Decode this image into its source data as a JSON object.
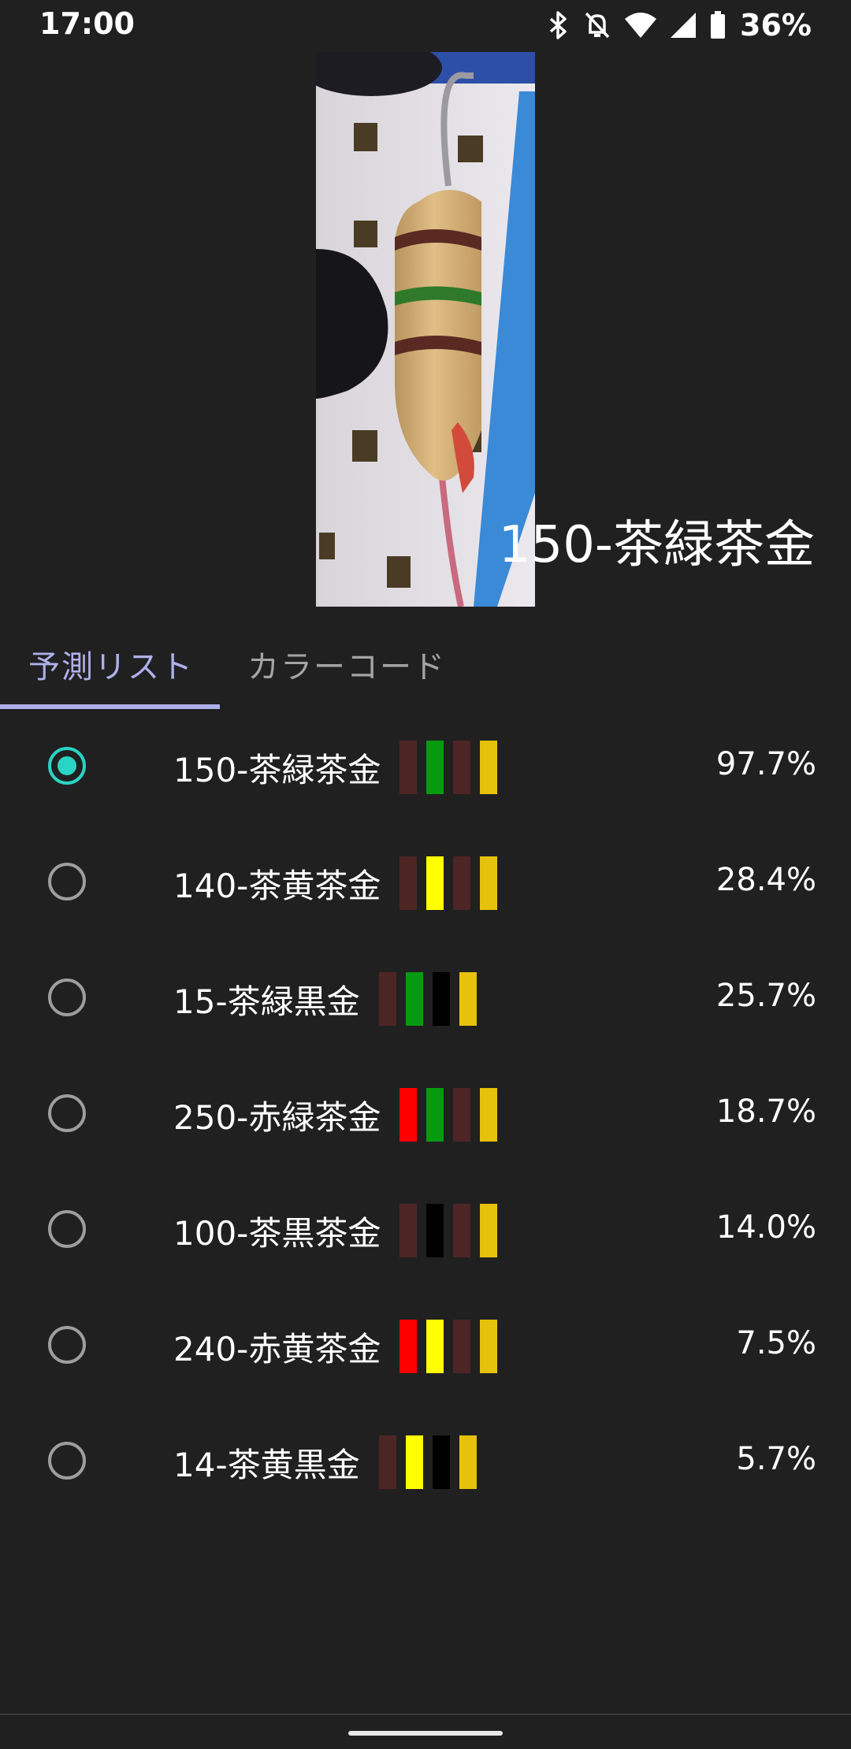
{
  "status": {
    "time": "17:00",
    "battery": "36%"
  },
  "prediction": "150-茶緑茶金",
  "tabs": [
    {
      "label": "予測リスト",
      "active": true
    },
    {
      "label": "カラーコード",
      "active": false
    }
  ],
  "band_colors": {
    "茶": "#4e2525",
    "緑": "#069a10",
    "黒": "#000000",
    "金": "#e6c20c",
    "黄": "#ffff00",
    "赤": "#ff0000"
  },
  "items": [
    {
      "label": "150-茶緑茶金",
      "bands": [
        "茶",
        "緑",
        "茶",
        "金"
      ],
      "percent": "97.7%",
      "selected": true
    },
    {
      "label": "140-茶黄茶金",
      "bands": [
        "茶",
        "黄",
        "茶",
        "金"
      ],
      "percent": "28.4%",
      "selected": false
    },
    {
      "label": "15-茶緑黒金",
      "bands": [
        "茶",
        "緑",
        "黒",
        "金"
      ],
      "percent": "25.7%",
      "selected": false
    },
    {
      "label": "250-赤緑茶金",
      "bands": [
        "赤",
        "緑",
        "茶",
        "金"
      ],
      "percent": "18.7%",
      "selected": false
    },
    {
      "label": "100-茶黒茶金",
      "bands": [
        "茶",
        "黒",
        "茶",
        "金"
      ],
      "percent": "14.0%",
      "selected": false
    },
    {
      "label": "240-赤黄茶金",
      "bands": [
        "赤",
        "黄",
        "茶",
        "金"
      ],
      "percent": "7.5%",
      "selected": false
    },
    {
      "label": "14-茶黄黒金",
      "bands": [
        "茶",
        "黄",
        "黒",
        "金"
      ],
      "percent": "5.7%",
      "selected": false
    }
  ]
}
